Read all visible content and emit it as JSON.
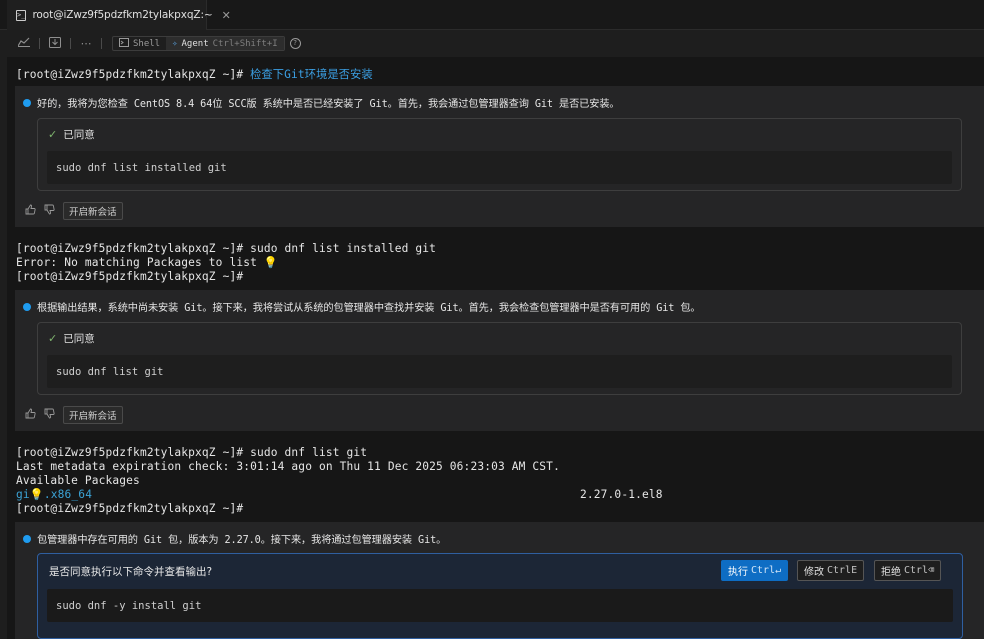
{
  "tab": {
    "title": "root@iZwz9f5pdzfkm2tylakpxqZ:~"
  },
  "toolbar": {
    "shell_label": "Shell",
    "agent_label": "Agent",
    "agent_shortcut": "Ctrl+Shift+I"
  },
  "terminal": {
    "prompt1": "[root@iZwz9f5pdzfkm2tylakpxqZ ~]# ",
    "cmd1": "检查下Git环境是否安装",
    "block2_line1": "[root@iZwz9f5pdzfkm2tylakpxqZ ~]# sudo dnf list installed git",
    "block2_line2": "Error: No matching Packages to list",
    "block2_line3": "[root@iZwz9f5pdzfkm2tylakpxqZ ~]#",
    "block3_line1": "[root@iZwz9f5pdzfkm2tylakpxqZ ~]# sudo dnf list git",
    "block3_line2": "Last metadata expiration check: 3:01:14 ago on Thu 11 Dec 2025 06:23:03 AM CST.",
    "block3_line3": "Available Packages",
    "block3_pkg_a": "gi",
    "block3_pkg_b": ".x86_64",
    "block3_version": "2.27.0-1.el8",
    "block3_line5": "[root@iZwz9f5pdzfkm2tylakpxqZ ~]#"
  },
  "agent": {
    "msg1": "好的，我将为您检查 CentOS 8.4 64位 SCC版 系统中是否已经安装了 Git。首先，我会通过包管理器查询 Git 是否已安装。",
    "card1_status": "已同意",
    "card1_command": "sudo dnf list installed git",
    "msg2": "根据输出结果，系统中尚未安装 Git。接下来，我将尝试从系统的包管理器中查找并安装 Git。首先，我会检查包管理器中是否有可用的 Git 包。",
    "card2_status": "已同意",
    "card2_command": "sudo dnf list git",
    "msg3": "包管理器中存在可用的 Git 包，版本为 2.27.0。接下来，我将通过包管理器安装 Git。",
    "approve_question": "是否同意执行以下命令并查看输出?",
    "exec_label": "执行",
    "exec_key": "Ctrl↵",
    "modify_label": "修改",
    "modify_key": "CtrlE",
    "reject_label": "拒绝",
    "reject_key": "Ctrl⌫",
    "card3_command": "sudo dnf -y install git",
    "new_chat_label": "开启新会话"
  }
}
